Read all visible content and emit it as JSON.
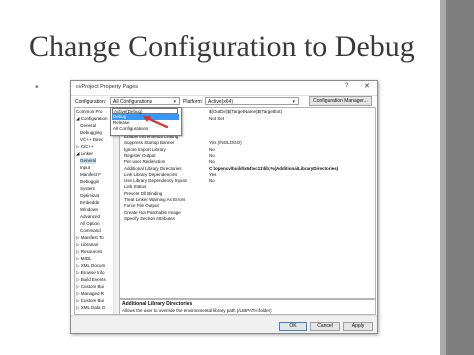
{
  "slide": {
    "title": "Change Configuration to Debug",
    "bullet": "•"
  },
  "dialog": {
    "title": "cvProject Property Pages",
    "help_glyph": "?",
    "close_glyph": "✕",
    "configuration_label": "Configuration:",
    "configuration_value": "All Configurations",
    "platform_label": "Platform:",
    "platform_value": "Active(x64)",
    "config_manager_label": "Configuration Manager...",
    "dropdown_options": [
      "Active(Debug)",
      "Debug",
      "Release",
      "All Configurations"
    ],
    "tree_items": [
      "Common Pro",
      "Configuration",
      "General",
      "Debugging",
      "VC++ Direc",
      "C/C++",
      "Linker",
      "General",
      "Input",
      "Manifest F",
      "Debuggin",
      "System",
      "Optimizat",
      "Embedde",
      "Windows",
      "Advanced",
      "All Option",
      "Command",
      "Manifest To",
      "Librarian",
      "Resources",
      "MIDL",
      "XML Docum",
      "Browse Info",
      "Build Events",
      "Custom Bui",
      "Managed R",
      "Custom Bui",
      "XML Data G"
    ],
    "properties": [
      {
        "name": "Enable Incremental Linking",
        "value": ""
      },
      {
        "name": "Suppress Startup Banner",
        "value": "Yes (/NOLOGO)"
      },
      {
        "name": "Ignore Import Library",
        "value": "No"
      },
      {
        "name": "Register Output",
        "value": "No"
      },
      {
        "name": "Per-user Redirection",
        "value": "No"
      },
      {
        "name": "Additional Library Directories",
        "value": "C:\\opencv\\build\\x64\\vc11\\lib;%(AdditionalLibraryDirectories)"
      },
      {
        "name": "Link Library Dependencies",
        "value": "Yes"
      },
      {
        "name": "Use Library Dependency Inputs",
        "value": "No"
      },
      {
        "name": "Link Status",
        "value": ""
      },
      {
        "name": "Prevent Dll Binding",
        "value": ""
      },
      {
        "name": "Treat Linker Warning As Errors",
        "value": ""
      },
      {
        "name": "Force File Output",
        "value": ""
      },
      {
        "name": "Create Hot Patchable Image",
        "value": ""
      },
      {
        "name": "Specify Section Attributes",
        "value": ""
      }
    ],
    "top_values": [
      "$(OutDir)$(TargetName)$(TargetExt)",
      "Not Set"
    ],
    "description_title": "Additional Library Directories",
    "description_text": "Allows the user to override the environmental library path (/LIBPATH:folder)",
    "buttons": {
      "ok": "OK",
      "cancel": "Cancel",
      "apply": "Apply"
    }
  },
  "colors": {
    "accent_bar": "#7f7f7f",
    "selection_blue": "#3399ff",
    "annotation_arrow": "#e03020"
  }
}
